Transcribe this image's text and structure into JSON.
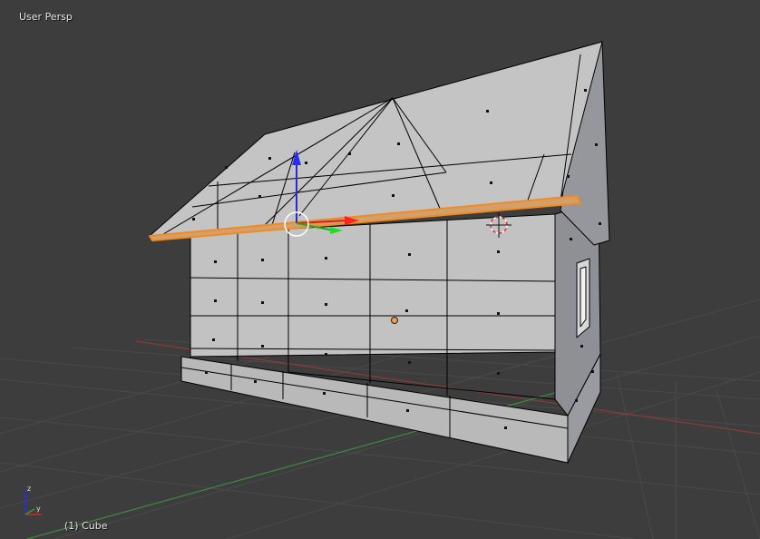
{
  "viewport": {
    "view_name": "User Persp",
    "object_info": "(1) Cube",
    "colors": {
      "background": "#3d3d3d",
      "grid": "#4a4a4a",
      "x_axis": "#8a3a3a",
      "y_axis": "#3f8a3f",
      "mesh_face": "#bdbdbd",
      "mesh_edge": "#000000",
      "selected_edge": "#f08a24"
    }
  },
  "mesh": {
    "object": "Cube",
    "mode": "edit"
  },
  "gizmos": {
    "transform_manipulator": [
      "x-arrow-red",
      "y-arrow-green",
      "z-arrow-blue"
    ],
    "cursor_3d": "3d-cursor-icon",
    "origin": "object-origin-dot",
    "axis_indicator": "view-axis-icon"
  }
}
